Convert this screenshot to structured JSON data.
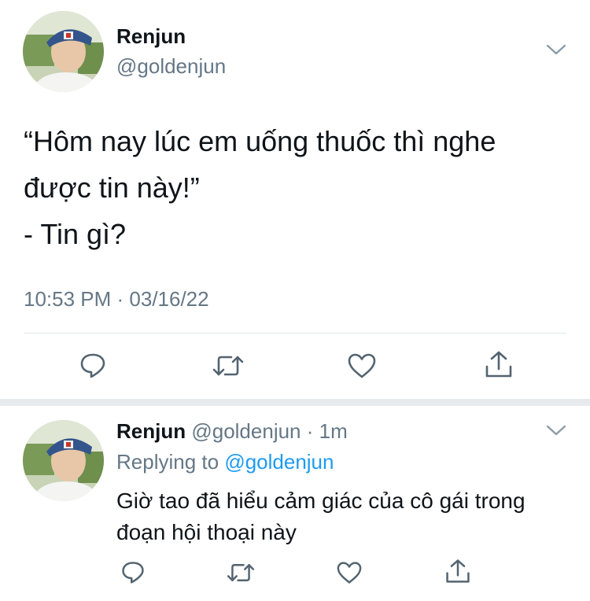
{
  "main_tweet": {
    "author_name": "Renjun",
    "author_handle": "@goldenjun",
    "text_line1": "“Hôm nay lúc em uống thuốc thì nghe",
    "text_line2": "được tin này!”",
    "text_line3": "- Tin gì?",
    "timestamp": "10:53 PM · 03/16/22"
  },
  "reply_tweet": {
    "author_name": "Renjun",
    "author_handle": "@goldenjun",
    "time_sep": "·",
    "time": "1m",
    "replying_prefix": "Replying to",
    "replying_handle": "@goldenjun",
    "text_line1": "Giờ tao đã hiểu cảm giác của cô gái trong",
    "text_line2": "đoạn hội thoại này"
  },
  "icons": {
    "reply": "comment-bubble-icon",
    "retweet": "retweet-arrows-icon",
    "like": "heart-icon",
    "share": "share-upload-icon",
    "more": "chevron-down-icon"
  },
  "colors": {
    "text": "#0f1419",
    "secondary": "#657786",
    "link": "#1d9bf0",
    "divider": "#e1e8ed"
  }
}
